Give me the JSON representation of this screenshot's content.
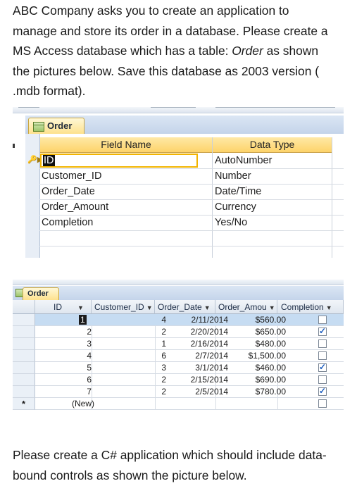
{
  "intro": {
    "line1": "ABC Company asks you to create an application to",
    "line2": "manage and store its order in a database. Please create a",
    "line3a": "MS Access database which has a table: ",
    "line3b": "Order",
    "line3c": " as shown",
    "line4": "the pictures below. Save this database as 2003 version (",
    "line5": ".mdb format)."
  },
  "design_view": {
    "tab_label": "Order",
    "headers": {
      "field_name": "Field Name",
      "data_type": "Data Type"
    },
    "fields": [
      {
        "name": "ID",
        "type": "AutoNumber",
        "primary_key": true
      },
      {
        "name": "Customer_ID",
        "type": "Number"
      },
      {
        "name": "Order_Date",
        "type": "Date/Time"
      },
      {
        "name": "Order_Amount",
        "type": "Currency"
      },
      {
        "name": "Completion",
        "type": "Yes/No"
      }
    ],
    "key_icon": "key-icon"
  },
  "datasheet_view": {
    "tab_label": "Order",
    "columns": [
      "ID",
      "Customer_ID",
      "Order_Date",
      "Order_Amou",
      "Completion"
    ],
    "rows": [
      {
        "id": "1",
        "customer_id": "4",
        "order_date": "2/11/2014",
        "order_amount": "$560.00",
        "completion": false
      },
      {
        "id": "2",
        "customer_id": "2",
        "order_date": "2/20/2014",
        "order_amount": "$650.00",
        "completion": true
      },
      {
        "id": "3",
        "customer_id": "1",
        "order_date": "2/16/2014",
        "order_amount": "$480.00",
        "completion": false
      },
      {
        "id": "4",
        "customer_id": "6",
        "order_date": "2/7/2014",
        "order_amount": "$1,500.00",
        "completion": false
      },
      {
        "id": "5",
        "customer_id": "3",
        "order_date": "3/1/2014",
        "order_amount": "$460.00",
        "completion": true
      },
      {
        "id": "6",
        "customer_id": "2",
        "order_date": "2/15/2014",
        "order_amount": "$690.00",
        "completion": false
      },
      {
        "id": "7",
        "customer_id": "2",
        "order_date": "2/5/2014",
        "order_amount": "$780.00",
        "completion": true
      }
    ],
    "new_row_marker": "*",
    "new_row_label": "(New)"
  },
  "outro": {
    "line1": "Please create a C# application which should include data-",
    "line2": "bound controls as shown the picture below."
  }
}
